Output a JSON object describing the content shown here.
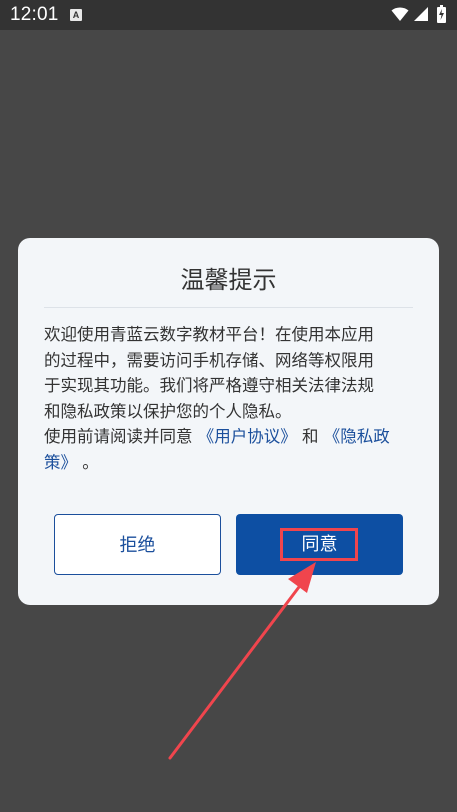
{
  "status_bar": {
    "time": "12:01",
    "notification_letter": "A"
  },
  "dialog": {
    "title": "温馨提示",
    "body_lines": [
      "欢迎使用青蓝云数字教材平台！在使用本应用",
      "的过程中，需要访问手机存储、网络等权限用",
      "于实现其功能。我们将严格遵守相关法律法规",
      "和隐私政策以保护您的个人隐私。"
    ],
    "line5_prefix": "使用前请阅读并同意 ",
    "user_agreement_link": "《用户协议》",
    "and_text": " 和 ",
    "privacy_policy_link_part1": "《隐私政",
    "privacy_policy_link_part2": "策》",
    "ending": " 。",
    "reject_label": "拒绝",
    "agree_label": "同意"
  },
  "colors": {
    "link": "#1b4f9c",
    "agree_button": "#0d4fa3",
    "annotation": "#f0454d",
    "overlay": "#474747"
  },
  "icons": [
    "wifi-icon",
    "signal-icon",
    "battery-charging-icon"
  ]
}
